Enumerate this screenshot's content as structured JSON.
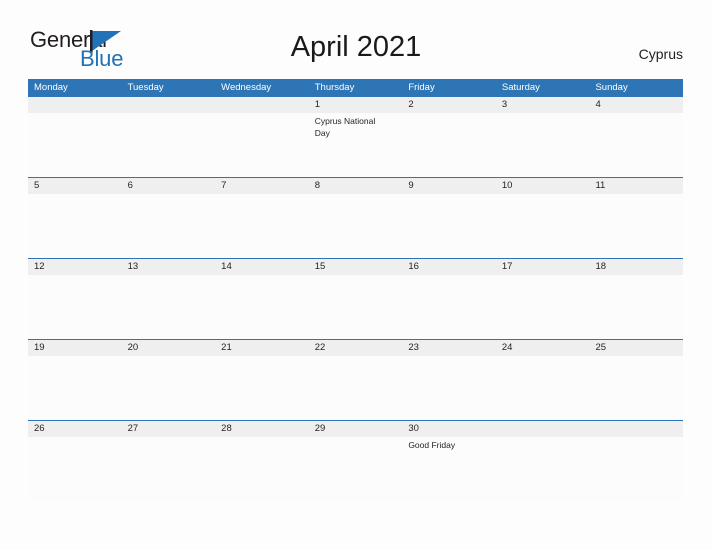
{
  "brand": {
    "name_part1": "General",
    "name_part2": "Blue",
    "flag_color": "#2272b8",
    "text_color": "#231f20"
  },
  "header": {
    "title": "April 2021",
    "country": "Cyprus",
    "header_bg": "#2e75b6",
    "band_bg": "#efefef"
  },
  "calendar": {
    "weekdays": [
      "Monday",
      "Tuesday",
      "Wednesday",
      "Thursday",
      "Friday",
      "Saturday",
      "Sunday"
    ],
    "weeks": [
      [
        {
          "day": "",
          "event": ""
        },
        {
          "day": "",
          "event": ""
        },
        {
          "day": "",
          "event": ""
        },
        {
          "day": "1",
          "event": "Cyprus National Day"
        },
        {
          "day": "2",
          "event": ""
        },
        {
          "day": "3",
          "event": ""
        },
        {
          "day": "4",
          "event": ""
        }
      ],
      [
        {
          "day": "5",
          "event": ""
        },
        {
          "day": "6",
          "event": ""
        },
        {
          "day": "7",
          "event": ""
        },
        {
          "day": "8",
          "event": ""
        },
        {
          "day": "9",
          "event": ""
        },
        {
          "day": "10",
          "event": ""
        },
        {
          "day": "11",
          "event": ""
        }
      ],
      [
        {
          "day": "12",
          "event": ""
        },
        {
          "day": "13",
          "event": ""
        },
        {
          "day": "14",
          "event": ""
        },
        {
          "day": "15",
          "event": ""
        },
        {
          "day": "16",
          "event": ""
        },
        {
          "day": "17",
          "event": ""
        },
        {
          "day": "18",
          "event": ""
        }
      ],
      [
        {
          "day": "19",
          "event": ""
        },
        {
          "day": "20",
          "event": ""
        },
        {
          "day": "21",
          "event": ""
        },
        {
          "day": "22",
          "event": ""
        },
        {
          "day": "23",
          "event": ""
        },
        {
          "day": "24",
          "event": ""
        },
        {
          "day": "25",
          "event": ""
        }
      ],
      [
        {
          "day": "26",
          "event": ""
        },
        {
          "day": "27",
          "event": ""
        },
        {
          "day": "28",
          "event": ""
        },
        {
          "day": "29",
          "event": ""
        },
        {
          "day": "30",
          "event": "Good Friday"
        },
        {
          "day": "",
          "event": ""
        },
        {
          "day": "",
          "event": ""
        }
      ]
    ]
  }
}
